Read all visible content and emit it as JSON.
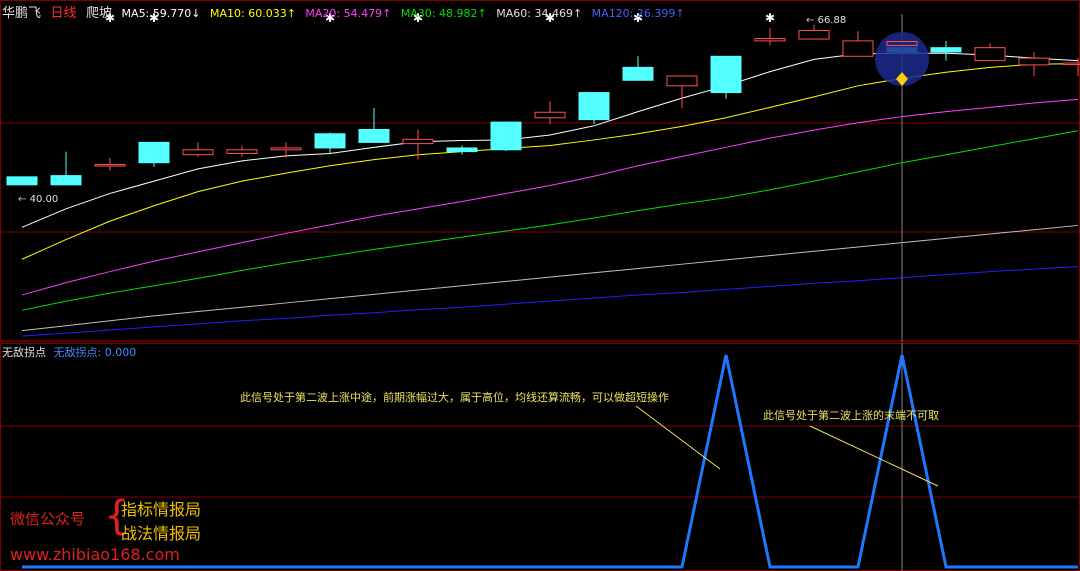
{
  "header": {
    "stock_name": "华鹏飞",
    "period": "日线",
    "mode": "爬坡",
    "ma5": "MA5: 59.770↓",
    "ma10": "MA10: 60.033↑",
    "ma20": "MA20: 54.479↑",
    "ma30": "MA30: 48.982↑",
    "ma60": "MA60: 34.469↑",
    "ma120": "MA120: 26.399↑"
  },
  "price_labels": {
    "high": "66.88",
    "low": "40.00"
  },
  "indicator": {
    "name": "无敌拐点",
    "value_text": "无敌拐点: 0.000"
  },
  "annotations": {
    "note1": "此信号处于第二波上涨中途，前期涨幅过大，属于高位，均线还算流畅，可以做超短操作",
    "note2": "此信号处于第二波上涨的末端不可取"
  },
  "branding": {
    "wechat": "微信公众号",
    "brace": "{",
    "line1": "指标情报局",
    "line2": "战法情报局",
    "url": "www.zhibiao168.com"
  },
  "colors": {
    "up": "#ff5050",
    "down": "#54ffff",
    "ma5": "#ffffff",
    "ma10": "#ffff00",
    "ma20": "#ff40ff",
    "ma30": "#00e000",
    "ma60": "#c0c0c0",
    "ma120": "#2020ff",
    "signal": "#1e78ff",
    "grid": "#800000",
    "crosshair": "#808080"
  },
  "chart_data": {
    "type": "candlestick",
    "candles": [
      {
        "o": 42.2,
        "c": 40.9,
        "h": 42.2,
        "l": 40.9
      },
      {
        "o": 42.4,
        "c": 40.9,
        "h": 46.3,
        "l": 40.9
      },
      {
        "o": 44.2,
        "c": 44.2,
        "h": 45.3,
        "l": 43.2
      },
      {
        "o": 47.8,
        "c": 44.5,
        "h": 47.8,
        "l": 43.8
      },
      {
        "o": 45.8,
        "c": 46.6,
        "h": 47.8,
        "l": 45.5
      },
      {
        "o": 46.0,
        "c": 46.6,
        "h": 47.3,
        "l": 45.5
      },
      {
        "o": 46.6,
        "c": 46.9,
        "h": 47.8,
        "l": 45.3
      },
      {
        "o": 49.2,
        "c": 46.9,
        "h": 49.4,
        "l": 45.9
      },
      {
        "o": 49.9,
        "c": 47.8,
        "h": 53.4,
        "l": 47.8
      },
      {
        "o": 47.6,
        "c": 48.3,
        "h": 49.9,
        "l": 45.0
      },
      {
        "o": 46.9,
        "c": 46.3,
        "h": 47.3,
        "l": 45.8
      },
      {
        "o": 51.1,
        "c": 46.6,
        "h": 51.2,
        "l": 46.4
      },
      {
        "o": 51.8,
        "c": 52.7,
        "h": 54.5,
        "l": 50.8
      },
      {
        "o": 55.9,
        "c": 51.5,
        "h": 55.9,
        "l": 50.8
      },
      {
        "o": 60.0,
        "c": 57.9,
        "h": 61.8,
        "l": 57.9
      },
      {
        "o": 57.0,
        "c": 58.6,
        "h": 58.6,
        "l": 53.4
      },
      {
        "o": 61.8,
        "c": 55.9,
        "h": 61.8,
        "l": 54.9
      },
      {
        "o": 64.3,
        "c": 64.7,
        "h": 66.4,
        "l": 63.6
      },
      {
        "o": 64.6,
        "c": 66.0,
        "h": 66.9,
        "l": 64.6
      },
      {
        "o": 61.8,
        "c": 64.3,
        "h": 65.9,
        "l": 61.8
      },
      {
        "o": 63.2,
        "c": 62.5,
        "h": 64.3,
        "l": 61.1
      },
      {
        "o": 63.2,
        "c": 62.5,
        "h": 64.3,
        "l": 61.1
      },
      {
        "o": 61.1,
        "c": 63.2,
        "h": 63.9,
        "l": 61.1
      },
      {
        "o": 60.4,
        "c": 61.5,
        "h": 62.5,
        "l": 58.6
      },
      {
        "o": 60.7,
        "c": 60.7,
        "h": 61.5,
        "l": 58.6
      }
    ],
    "ma": {
      "MA5": [
        34.0,
        37.0,
        39.5,
        41.5,
        43.5,
        44.8,
        45.6,
        46.0,
        47.0,
        47.9,
        48.1,
        48.2,
        49.0,
        50.5,
        52.8,
        55.0,
        57.0,
        59.3,
        61.3,
        62.2,
        62.3,
        62.3,
        62.0,
        61.5,
        61.1
      ],
      "MA10": [
        28.8,
        32.0,
        35.0,
        37.5,
        39.8,
        41.5,
        42.8,
        44.0,
        45.0,
        45.8,
        46.3,
        46.8,
        47.3,
        48.2,
        49.2,
        50.4,
        51.8,
        53.5,
        55.2,
        57.0,
        58.2,
        59.2,
        60.0,
        60.5,
        60.6
      ],
      "MA20": [
        23.0,
        25.0,
        26.8,
        28.5,
        30.0,
        31.5,
        33.0,
        34.4,
        35.8,
        37.0,
        38.2,
        39.5,
        40.8,
        42.3,
        44.0,
        45.5,
        47.0,
        48.5,
        49.8,
        51.0,
        52.0,
        52.8,
        53.5,
        54.2,
        54.8
      ],
      "MA30": [
        20.5,
        22.0,
        23.3,
        24.5,
        25.7,
        27.0,
        28.2,
        29.3,
        30.4,
        31.4,
        32.4,
        33.4,
        34.4,
        35.5,
        36.7,
        37.8,
        38.8,
        40.1,
        41.5,
        43.0,
        44.5,
        45.8,
        47.1,
        48.4,
        49.7
      ],
      "MA60": [
        17.2,
        18.0,
        18.8,
        19.6,
        20.3,
        21.0,
        21.7,
        22.4,
        23.1,
        23.8,
        24.5,
        25.2,
        25.9,
        26.6,
        27.3,
        28.0,
        28.7,
        29.4,
        30.1,
        30.8,
        31.5,
        32.2,
        32.9,
        33.6,
        34.3
      ],
      "MA120": [
        16.3,
        16.8,
        17.3,
        17.8,
        18.3,
        18.8,
        19.2,
        19.7,
        20.1,
        20.6,
        21.0,
        21.5,
        22.0,
        22.5,
        23.0,
        23.4,
        23.9,
        24.4,
        24.9,
        25.3,
        25.8,
        26.3,
        26.8,
        27.2,
        27.6
      ]
    },
    "signal": [
      0,
      0,
      0,
      0,
      0,
      0,
      0,
      0,
      0,
      0,
      0,
      0,
      0,
      0,
      0,
      0,
      1,
      0,
      0,
      0,
      1,
      0,
      0,
      0,
      0
    ],
    "star_markers": [
      2,
      3,
      7,
      9,
      12,
      14,
      17
    ],
    "ylim": [
      16,
      69
    ]
  }
}
